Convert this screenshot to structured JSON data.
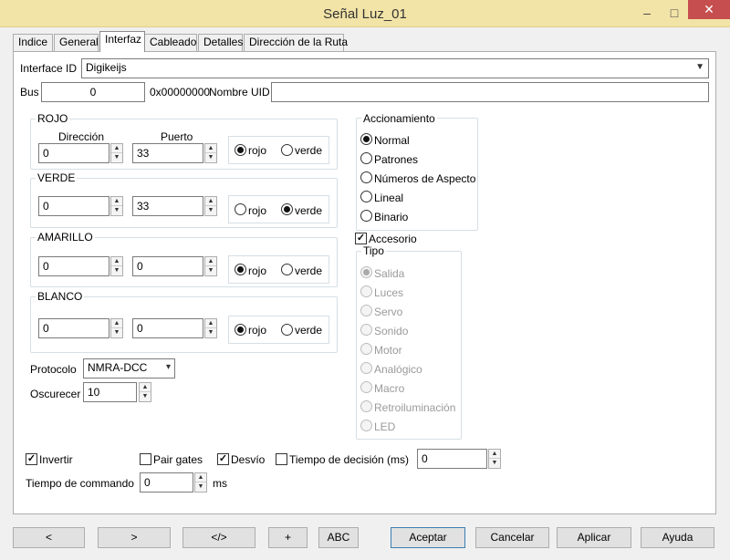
{
  "window": {
    "title": "Señal Luz_01",
    "minimize": "–",
    "maximize": "□",
    "close": "✕"
  },
  "tabs": [
    {
      "label": "Indice"
    },
    {
      "label": "General"
    },
    {
      "label": "Interfaz",
      "active": true
    },
    {
      "label": "Cableado"
    },
    {
      "label": "Detalles"
    },
    {
      "label": "Dirección de la Ruta"
    }
  ],
  "interface": {
    "id_label": "Interface ID",
    "id_value": "Digikeijs"
  },
  "bus": {
    "label": "Bus",
    "value": "0",
    "hex": "0x00000000",
    "uid_label": "Nombre UID",
    "uid_value": ""
  },
  "headers": {
    "direccion": "Dirección",
    "puerto": "Puerto"
  },
  "rojo": {
    "title": "ROJO",
    "dir": "0",
    "port": "33",
    "opt1": "rojo",
    "opt2": "verde",
    "selected": "rojo"
  },
  "verde": {
    "title": "VERDE",
    "dir": "0",
    "port": "33",
    "opt1": "rojo",
    "opt2": "verde",
    "selected": "verde"
  },
  "amarillo": {
    "title": "AMARILLO",
    "dir": "0",
    "port": "0",
    "opt1": "rojo",
    "opt2": "verde",
    "selected": "rojo"
  },
  "blanco": {
    "title": "BLANCO",
    "dir": "0",
    "port": "0",
    "opt1": "rojo",
    "opt2": "verde",
    "selected": "rojo"
  },
  "protocolo": {
    "label": "Protocolo",
    "value": "NMRA-DCC"
  },
  "oscurecer": {
    "label": "Oscurecer",
    "value": "10"
  },
  "accionamiento": {
    "title": "Accionamiento",
    "options": [
      "Normal",
      "Patrones",
      "Números de Aspecto",
      "Lineal",
      "Binario"
    ],
    "selected": "Normal"
  },
  "accesorio": {
    "label": "Accesorio",
    "checked": true
  },
  "tipo": {
    "title": "Tipo",
    "options": [
      "Salida",
      "Luces",
      "Servo",
      "Sonido",
      "Motor",
      "Analógico",
      "Macro",
      "Retroiluminación",
      "LED"
    ],
    "selected": "Salida"
  },
  "flags": {
    "invertir": {
      "label": "Invertir",
      "checked": true
    },
    "pair_gates": {
      "label": "Pair gates",
      "checked": false
    },
    "desvio": {
      "label": "Desvío",
      "checked": true
    },
    "tiempo_decision": {
      "label": "Tiempo de decisión (ms)",
      "checked": false,
      "value": "0"
    }
  },
  "tiempo_commando": {
    "label": "Tiempo de commando",
    "value": "0",
    "unit": "ms"
  },
  "buttons": {
    "prev": "<",
    "next": ">",
    "code": "</>",
    "plus": "+",
    "abc": "ABC",
    "accept": "Aceptar",
    "cancel": "Cancelar",
    "apply": "Aplicar",
    "help": "Ayuda"
  }
}
